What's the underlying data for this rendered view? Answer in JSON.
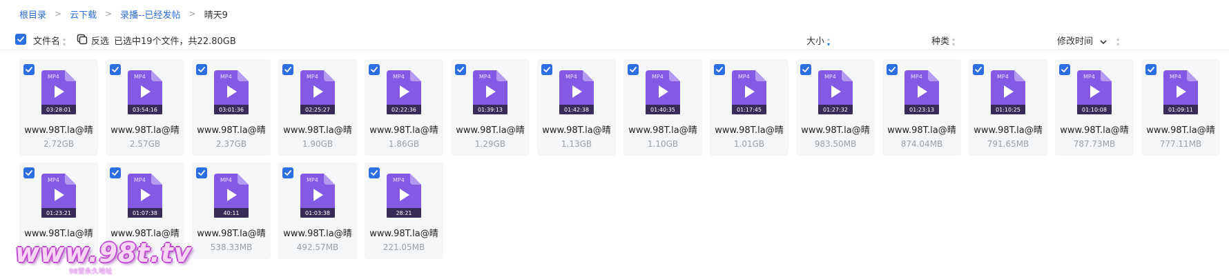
{
  "breadcrumb": [
    {
      "label": "根目录"
    },
    {
      "label": "云下载"
    },
    {
      "label": "录播--已经发帖"
    },
    {
      "label": "晴天9"
    }
  ],
  "header": {
    "filename_label": "文件名",
    "invert_label": "反选",
    "selection_status": "已选中19个文件，共22.80GB",
    "size_label": "大小",
    "type_label": "种类",
    "modified_label": "修改时间"
  },
  "colors": {
    "accent": "#2c6fe3",
    "file_icon": "#8459e3"
  },
  "files": [
    {
      "name": "www.98T.la@晴",
      "size": "2.72GB",
      "duration": "03:28:01",
      "badge": "MP4"
    },
    {
      "name": "www.98T.la@晴",
      "size": "2.57GB",
      "duration": "03:54:16",
      "badge": "MP4"
    },
    {
      "name": "www.98T.la@晴",
      "size": "2.37GB",
      "duration": "03:01:36",
      "badge": "MP4"
    },
    {
      "name": "www.98T.la@晴",
      "size": "1.90GB",
      "duration": "02:25:27",
      "badge": "MP4"
    },
    {
      "name": "www.98T.la@晴",
      "size": "1.86GB",
      "duration": "02:22:36",
      "badge": "MP4"
    },
    {
      "name": "www.98T.la@晴",
      "size": "1.29GB",
      "duration": "01:39:13",
      "badge": "MP4"
    },
    {
      "name": "www.98T.la@晴",
      "size": "1.13GB",
      "duration": "01:42:38",
      "badge": "MP4"
    },
    {
      "name": "www.98T.la@晴",
      "size": "1.10GB",
      "duration": "01:40:35",
      "badge": "MP4"
    },
    {
      "name": "www.98T.la@晴",
      "size": "1.01GB",
      "duration": "01:17:45",
      "badge": "MP4"
    },
    {
      "name": "www.98T.la@晴",
      "size": "983.50MB",
      "duration": "01:27:32",
      "badge": "MP4"
    },
    {
      "name": "www.98T.la@晴",
      "size": "874.04MB",
      "duration": "01:23:13",
      "badge": "MP4"
    },
    {
      "name": "www.98T.la@晴",
      "size": "791.65MB",
      "duration": "01:10:25",
      "badge": "MP4"
    },
    {
      "name": "www.98T.la@晴",
      "size": "787.73MB",
      "duration": "01:10:08",
      "badge": "MP4"
    },
    {
      "name": "www.98T.la@晴",
      "size": "777.11MB",
      "duration": "01:09:11",
      "badge": "MP4"
    },
    {
      "name": "www.98T.la@晴",
      "size": "",
      "duration": "01:23:21",
      "badge": "MP4"
    },
    {
      "name": "www.98T.la@晴",
      "size": "",
      "duration": "01:07:38",
      "badge": "MP4"
    },
    {
      "name": "www.98T.la@晴",
      "size": "538.33MB",
      "duration": "40:11",
      "badge": "MP4"
    },
    {
      "name": "www.98T.la@晴",
      "size": "492.57MB",
      "duration": "01:03:38",
      "badge": "MP4"
    },
    {
      "name": "www.98T.la@晴",
      "size": "221.05MB",
      "duration": "28:21",
      "badge": "MP4"
    }
  ],
  "watermark": {
    "text": "www.98t.tv",
    "sub": "98堂永久地址"
  }
}
